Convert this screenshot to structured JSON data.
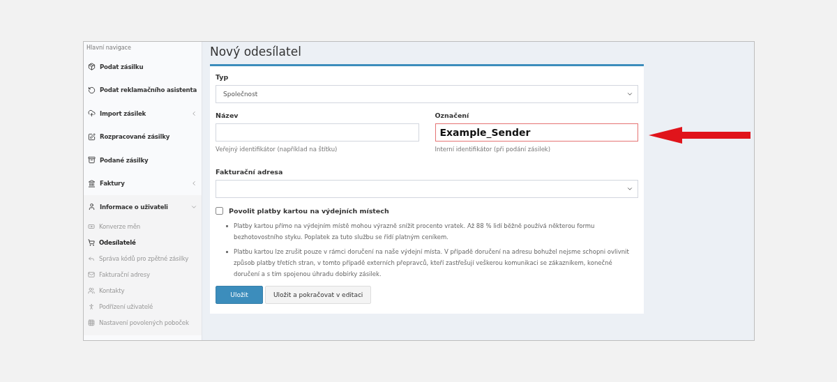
{
  "sidebar": {
    "heading": "Hlavní navigace",
    "items": [
      {
        "label": "Podat zásilku"
      },
      {
        "label": "Podat reklamačního asistenta"
      },
      {
        "label": "Import zásilek",
        "expanded": false
      },
      {
        "label": "Rozpracované zásilky"
      },
      {
        "label": "Podané zásilky"
      },
      {
        "label": "Faktury",
        "expanded": false
      },
      {
        "label": "Informace o uživateli",
        "expanded": true,
        "children": [
          {
            "label": "Konverze měn",
            "selected": false
          },
          {
            "label": "Odesílatelé",
            "selected": true
          },
          {
            "label": "Správa kódů pro zpětné zásilky",
            "selected": false
          },
          {
            "label": "Fakturační adresy",
            "selected": false
          },
          {
            "label": "Kontakty",
            "selected": false
          },
          {
            "label": "Podřízení uživatelé",
            "selected": false
          },
          {
            "label": "Nastavení povolených poboček",
            "selected": false
          }
        ]
      }
    ]
  },
  "page_title": "Nový odesílatel",
  "form": {
    "type": {
      "label": "Typ",
      "value": "Společnost"
    },
    "name": {
      "label": "Název",
      "help": "Veřejný identifikátor (například na štítku)"
    },
    "designation": {
      "label": "Označení",
      "value": "Example_Sender",
      "invalid": true,
      "help": "Interní identifikátor (při podání zásilek)"
    },
    "billing_address": {
      "label": "Fakturační adresa"
    },
    "card_payments": {
      "label": "Povolit platby kartou na výdejních místech",
      "checked": false
    },
    "notes": [
      "Platby kartou přímo na výdejním místě mohou výrazně snížit procento vratek. Až 88 % lidí běžně používá některou formu bezhotovostního styku. Poplatek za tuto službu se řídí platným ceníkem.",
      "Platbu kartou lze zrušit pouze v rámci doručení na naše výdejní místa. V případě doručení na adresu bohužel nejsme schopni ovlivnit způsob platby třetích stran, v tomto případě externích přepravců, kteří zastřešují veškerou komunikaci se zákazníkem, konečné doručení a s tím spojenou úhradu dobírky zásilek."
    ],
    "buttons": [
      {
        "label": "Uložit",
        "kind": "primary"
      },
      {
        "label": "Uložit a pokračovat v editaci",
        "kind": "default"
      }
    ]
  }
}
